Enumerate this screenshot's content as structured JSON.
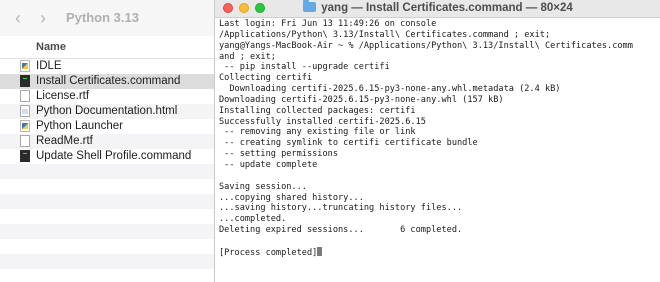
{
  "finder": {
    "title": "Python 3.13",
    "back_icon": "chevron-left-icon",
    "forward_icon": "chevron-right-icon",
    "column_header": "Name",
    "files": [
      {
        "name": "IDLE",
        "icon": "python-app-icon"
      },
      {
        "name": "Install Certificates.command",
        "icon": "terminal-script-icon",
        "selected": true
      },
      {
        "name": "License.rtf",
        "icon": "document-icon"
      },
      {
        "name": "Python Documentation.html",
        "icon": "html-document-icon"
      },
      {
        "name": "Python Launcher",
        "icon": "python-app-icon"
      },
      {
        "name": "ReadMe.rtf",
        "icon": "document-icon"
      },
      {
        "name": "Update Shell Profile.command",
        "icon": "terminal-script-icon"
      }
    ]
  },
  "terminal": {
    "title": "yang — Install Certificates.command — 80×24",
    "colors": {
      "close": "#fe5f57",
      "minimize": "#febc2e",
      "maximize": "#28c840"
    },
    "lines": [
      "Last login: Fri Jun 13 11:49:26 on console",
      "/Applications/Python\\ 3.13/Install\\ Certificates.command ; exit;",
      "yang@Yangs-MacBook-Air ~ % /Applications/Python\\ 3.13/Install\\ Certificates.comm",
      "and ; exit;",
      " -- pip install --upgrade certifi",
      "Collecting certifi",
      "  Downloading certifi-2025.6.15-py3-none-any.whl.metadata (2.4 kB)",
      "Downloading certifi-2025.6.15-py3-none-any.whl (157 kB)",
      "Installing collected packages: certifi",
      "Successfully installed certifi-2025.6.15",
      " -- removing any existing file or link",
      " -- creating symlink to certifi certificate bundle",
      " -- setting permissions",
      " -- update complete",
      "",
      "Saving session...",
      "...copying shared history...",
      "...saving history...truncating history files...",
      "...completed.",
      "Deleting expired sessions...       6 completed.",
      "",
      "[Process completed]"
    ]
  }
}
